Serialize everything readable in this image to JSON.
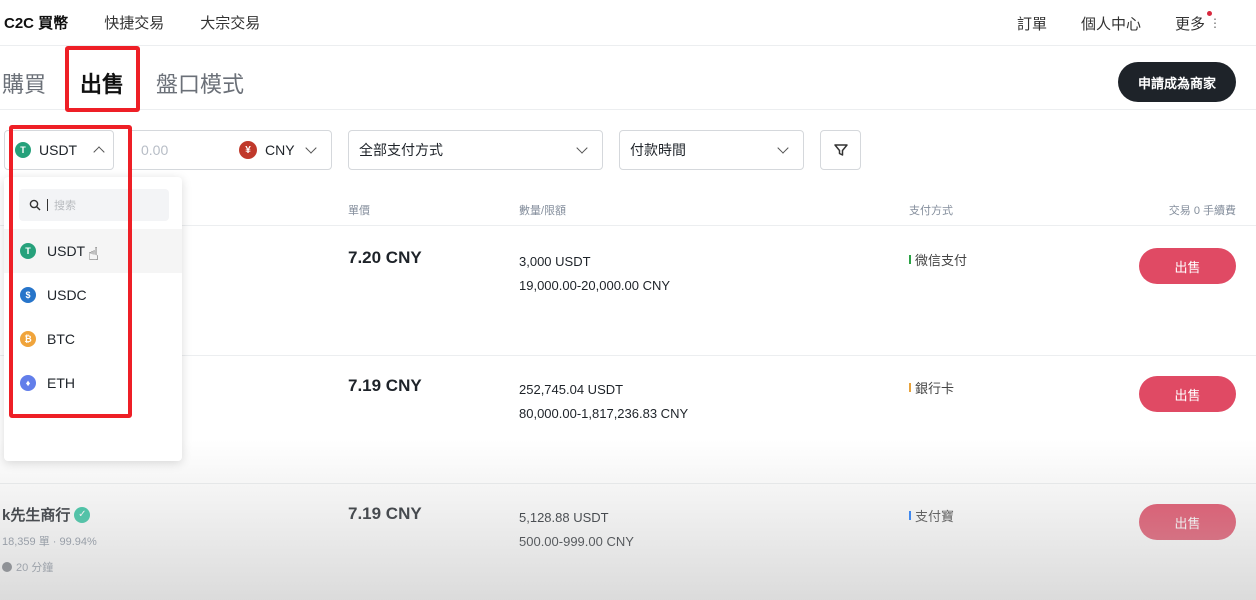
{
  "topnav": {
    "left": [
      "C2C 買幣",
      "快捷交易",
      "大宗交易"
    ],
    "right": [
      "訂單",
      "個人中心",
      "更多"
    ]
  },
  "tabs": [
    "購買",
    "出售",
    "盤口模式"
  ],
  "merchant_button": "申請成為商家",
  "filters": {
    "coin": "USDT",
    "amount_placeholder": "0.00",
    "currency": "CNY",
    "payment": "全部支付方式",
    "pay_time": "付款時間"
  },
  "dropdown": {
    "search_placeholder": "搜索",
    "items": [
      "USDT",
      "USDC",
      "BTC",
      "ETH"
    ]
  },
  "table": {
    "headers": [
      "單價",
      "數量/限額",
      "支付方式",
      "交易 0 手續費"
    ],
    "rows": [
      {
        "price": "7.20 CNY",
        "qty": "3,000 USDT",
        "limit": "19,000.00-20,000.00 CNY",
        "payment": "微信支付",
        "action": "出售"
      },
      {
        "price": "7.19 CNY",
        "qty": "252,745.04 USDT",
        "limit": "80,000.00-1,817,236.83 CNY",
        "payment": "銀行卡",
        "action": "出售"
      },
      {
        "merchant": "k先生商行",
        "stats": "18,359 單 · 99.94%",
        "time": "20 分鐘",
        "price": "7.19 CNY",
        "qty": "5,128.88 USDT",
        "limit": "500.00-999.00 CNY",
        "payment": "支付寶",
        "action": "出售"
      }
    ]
  },
  "colors": {
    "sell_button": "#e04a64",
    "highlight": "#ee1f26",
    "wechat": "#2ba245",
    "bank": "#e8a33d",
    "alipay": "#1677ff"
  }
}
